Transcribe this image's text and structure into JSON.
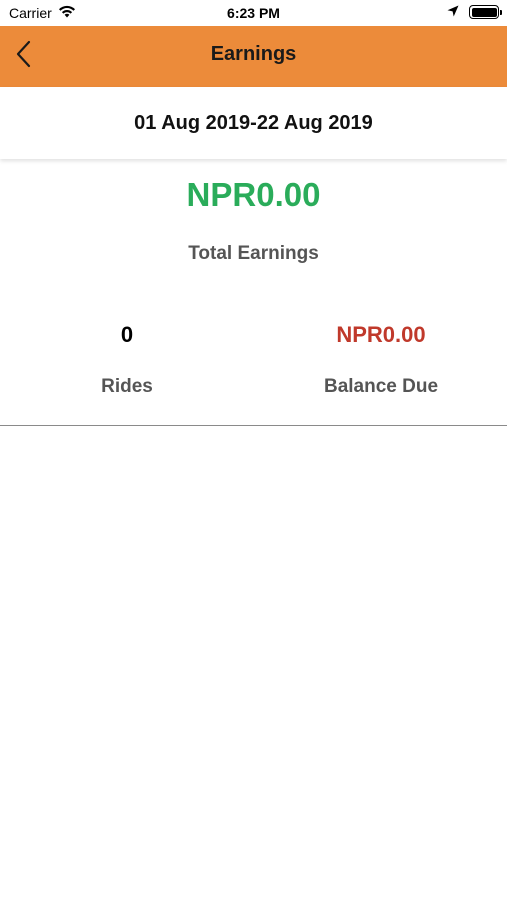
{
  "status_bar": {
    "carrier": "Carrier",
    "time": "6:23 PM",
    "icons": [
      "wifi-icon",
      "location-arrow-icon",
      "battery-icon"
    ]
  },
  "nav": {
    "title": "Earnings",
    "back_icon": "chevron-left-icon",
    "background_color": "#ec8b3a"
  },
  "date_range": "01 Aug 2019-22 Aug 2019",
  "total": {
    "amount": "NPR0.00",
    "label": "Total Earnings",
    "color": "#2aac5a"
  },
  "stats": [
    {
      "value": "0",
      "label": "Rides"
    },
    {
      "value": "NPR0.00",
      "label": "Balance Due",
      "color": "#c0392b"
    }
  ]
}
